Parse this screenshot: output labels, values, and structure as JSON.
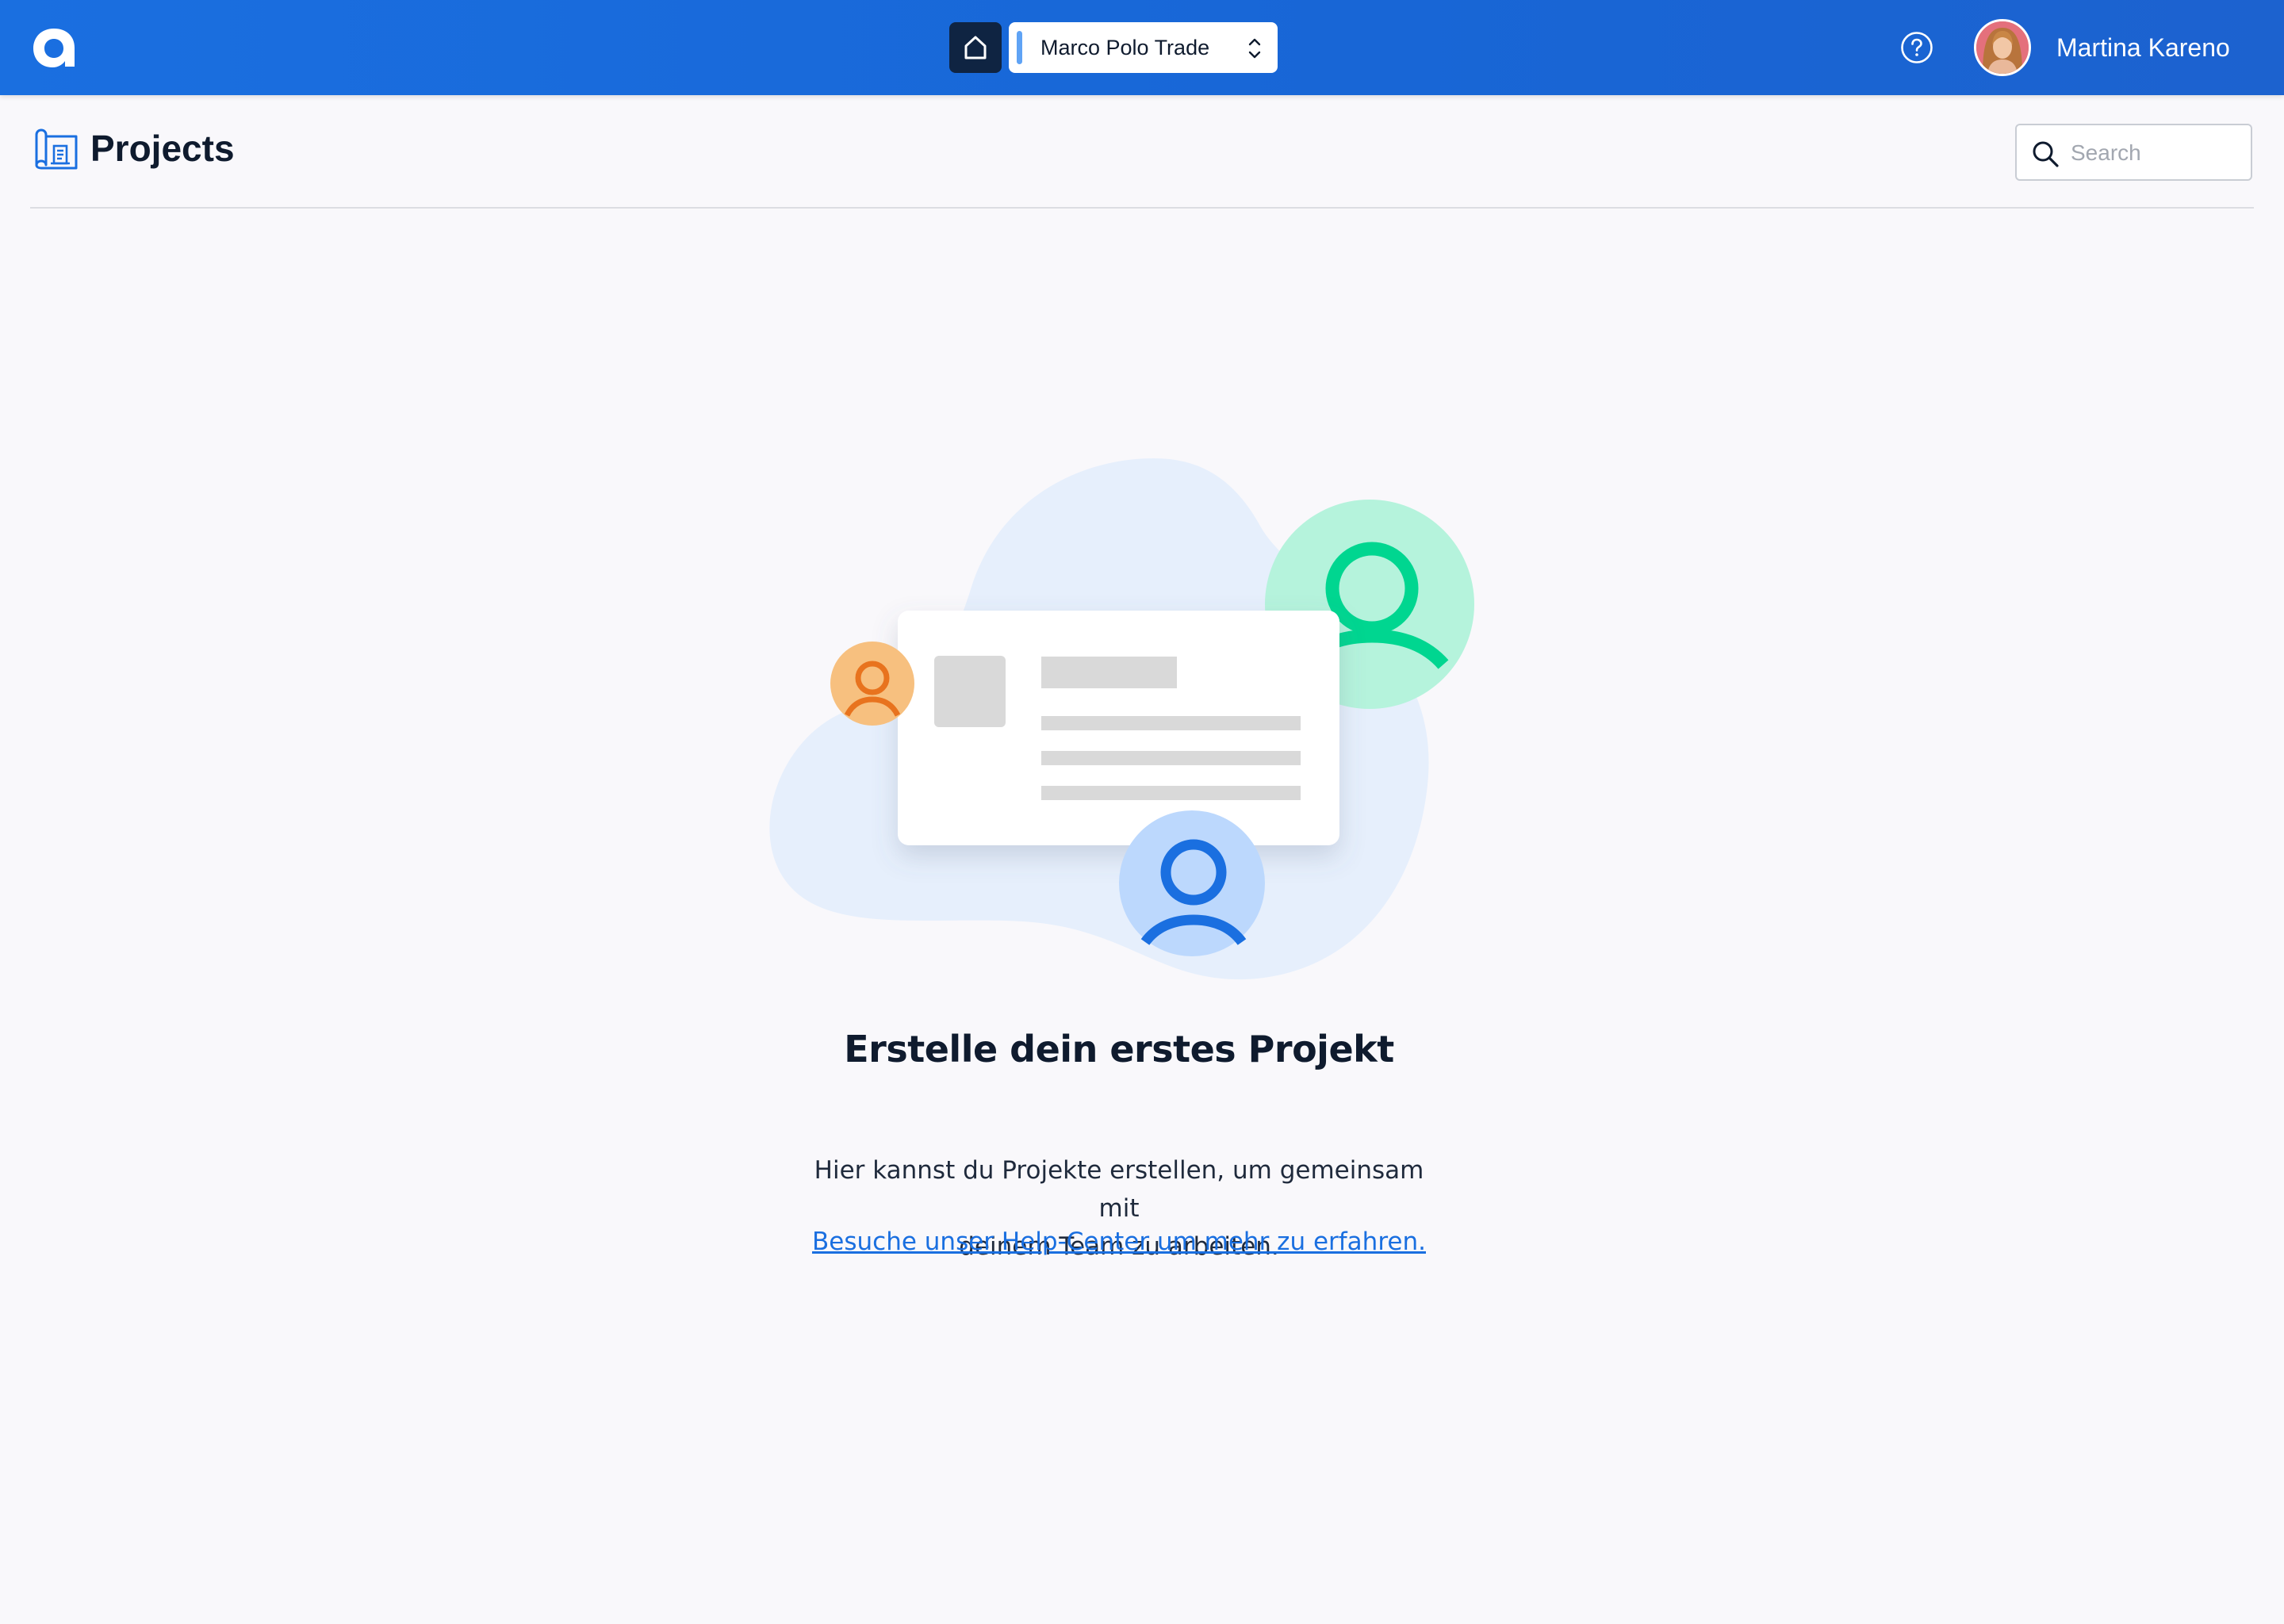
{
  "topbar": {
    "organization": "Marco Polo Trade",
    "user_name": "Martina Kareno",
    "icons": {
      "logo": "app-logo",
      "home": "home-icon",
      "org_switch": "chevron-updown-icon",
      "help": "help-circle-icon",
      "avatar": "user-avatar"
    }
  },
  "page": {
    "title": "Projects",
    "title_icon": "projects-icon",
    "search": {
      "placeholder": "Search",
      "value": ""
    }
  },
  "empty_state": {
    "title": "Erstelle dein erstes Projekt",
    "description_line1": "Hier kannst du Projekte erstellen, um gemeinsam mit",
    "description_line2": "deinem Team zu arbeiten.",
    "help_link": "Besuche unser Help-Center um mehr zu erfahren."
  },
  "colors": {
    "topbar": "#1a6fe0",
    "accent_blue": "#1a6fe0",
    "green": "#00d690",
    "orange": "#e8731e",
    "blob": "#e6effc"
  }
}
